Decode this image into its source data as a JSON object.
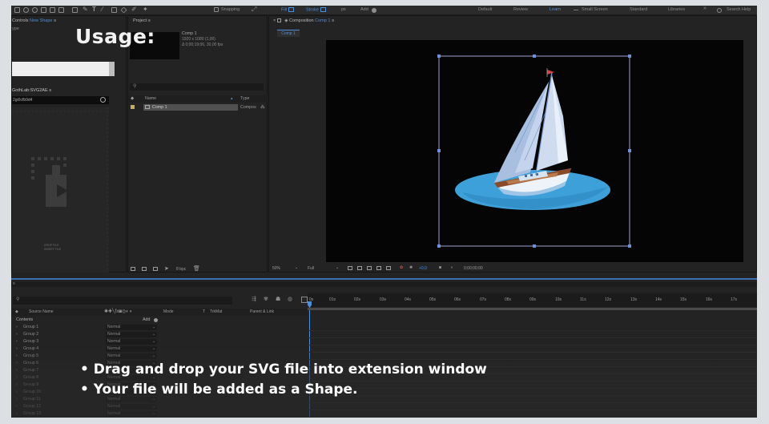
{
  "toolbar": {
    "snapping": "Snapping",
    "fill": "Fill",
    "stroke": "Stroke",
    "stroke_unit": "px",
    "add": "Add",
    "workspaces": [
      "Default",
      "Review",
      "Learn",
      "Small Screen",
      "Standard",
      "Libraries"
    ],
    "active_workspace": "Learn",
    "search_help": "Search Help"
  },
  "effect_controls": {
    "title_prefix": "Controls",
    "title_layer": "New Shape",
    "subtitle": "ype"
  },
  "extension": {
    "title": "GothLab:SVG2AE",
    "field": "2gi0cfb9d4",
    "drop_hint_1": "DROP FILE",
    "drop_hint_2": "INSERT FILE"
  },
  "project": {
    "title": "Project",
    "comp_name": "Comp 1",
    "comp_size": "1920 x 1080 (1,00)",
    "comp_duration": "Δ 0;00;19;06, 30,00 fps",
    "col_name": "Name",
    "col_type": "Type",
    "item_name": "Comp 1",
    "item_type": "Compos",
    "bpc": "8 bpc"
  },
  "composition": {
    "title_prefix": "Composition",
    "title_comp": "Comp 1",
    "tab": "Comp 1",
    "zoom": "50%",
    "resolution": "Full",
    "exposure": "+0,0",
    "timecode": "0;00;00;00"
  },
  "timeline": {
    "col_source": "Source Name",
    "col_mode": "Mode",
    "col_trkmat": "TrkMat",
    "col_parent": "Parent & Link",
    "contents": "Contents",
    "add": "Add",
    "ticks": [
      "0s",
      "01s",
      "02s",
      "03s",
      "04s",
      "05s",
      "06s",
      "07s",
      "08s",
      "09s",
      "10s",
      "11s",
      "12s",
      "13s",
      "14s",
      "15s",
      "16s",
      "17s"
    ],
    "groups": [
      {
        "name": "Group 1",
        "mode": "Normal"
      },
      {
        "name": "Group 2",
        "mode": "Normal"
      },
      {
        "name": "Group 3",
        "mode": "Normal"
      },
      {
        "name": "Group 4",
        "mode": "Normal"
      },
      {
        "name": "Group 5",
        "mode": "Normal"
      },
      {
        "name": "Group 6",
        "mode": "Normal"
      },
      {
        "name": "Group 7",
        "mode": "Normal"
      },
      {
        "name": "Group 8",
        "mode": "Normal"
      },
      {
        "name": "Group 9",
        "mode": "Normal"
      },
      {
        "name": "Group 10",
        "mode": "Normal"
      },
      {
        "name": "Group 11",
        "mode": "Normal"
      },
      {
        "name": "Group 12",
        "mode": "Normal"
      },
      {
        "name": "Group 13",
        "mode": "Normal"
      }
    ]
  },
  "overlay": {
    "usage": "Usage:",
    "bullets": [
      "• Drag and drop your SVG file into extension window",
      "• Your file will be added as a Shape."
    ]
  },
  "colors": {
    "accent": "#4d8fd8",
    "water": "#3da0d8",
    "canvas": "#050505"
  }
}
